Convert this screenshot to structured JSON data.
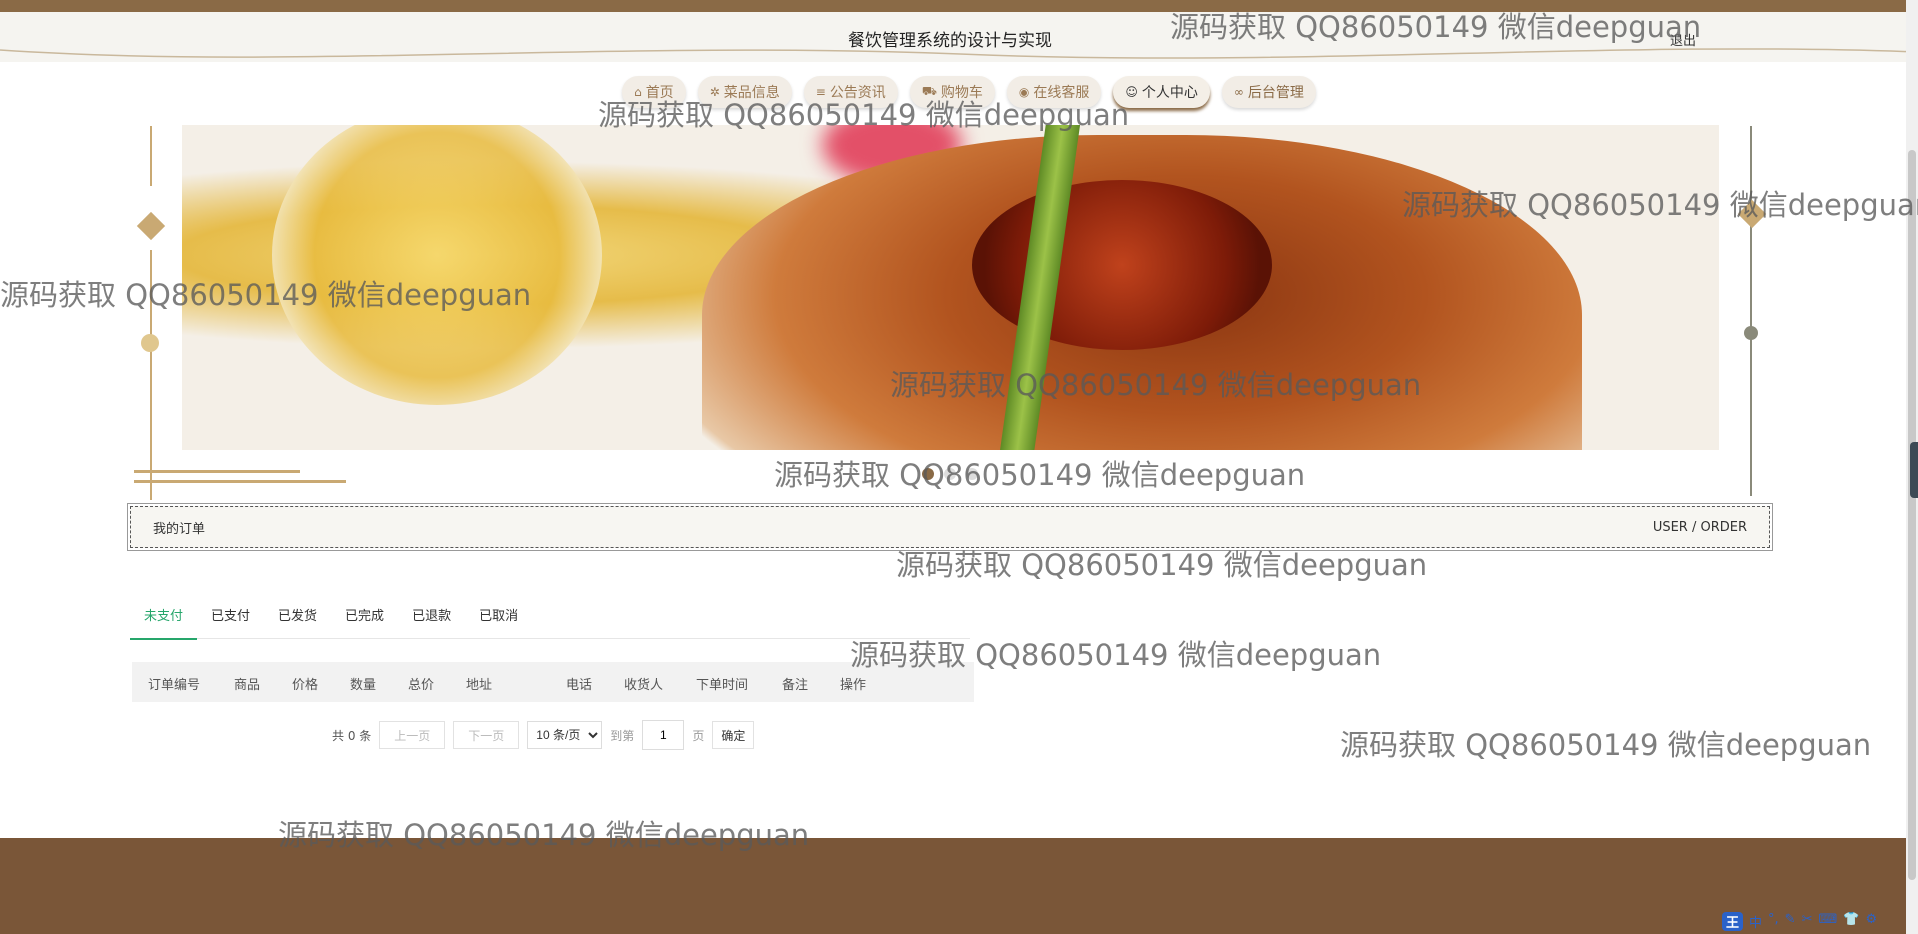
{
  "header": {
    "title": "餐饮管理系统的设计与实现",
    "logout_label": "退出"
  },
  "nav": {
    "items": [
      {
        "icon": "home-icon",
        "glyph": "⌂",
        "label": "首页"
      },
      {
        "icon": "dish-icon",
        "glyph": "✲",
        "label": "菜品信息"
      },
      {
        "icon": "notice-icon",
        "glyph": "≡",
        "label": "公告资讯"
      },
      {
        "icon": "cart-icon",
        "glyph": "⛟",
        "label": "购物车"
      },
      {
        "icon": "chat-icon",
        "glyph": "◉",
        "label": "在线客服"
      },
      {
        "icon": "user-icon",
        "glyph": "☺",
        "label": "个人中心",
        "active": true
      },
      {
        "icon": "link-icon",
        "glyph": "∞",
        "label": "后台管理"
      }
    ]
  },
  "section": {
    "title": "我的订单",
    "subtitle": "USER / ORDER"
  },
  "tabs": [
    {
      "label": "未支付",
      "active": true
    },
    {
      "label": "已支付"
    },
    {
      "label": "已发货"
    },
    {
      "label": "已完成"
    },
    {
      "label": "已退款"
    },
    {
      "label": "已取消"
    }
  ],
  "table": {
    "columns": [
      "订单编号",
      "商品",
      "价格",
      "数量",
      "总价",
      "地址",
      "电话",
      "收货人",
      "下单时间",
      "备注",
      "操作"
    ],
    "rows": []
  },
  "pager": {
    "total": "共 0 条",
    "prev": "上一页",
    "next": "下一页",
    "page_size": "10 条/页",
    "page_size_options": [
      "10 条/页"
    ],
    "goto_label": "到第",
    "page_value": "1",
    "page_suffix": "页",
    "confirm": "确定"
  },
  "carousel": {
    "count": 3,
    "active_index": 0
  },
  "watermark_text": "源码获取 QQ86050149 微信deepguan",
  "ime": {
    "badge": "王",
    "items": [
      "中",
      "°,",
      "✎",
      "✂",
      "⌨",
      "👕",
      "⚙"
    ]
  },
  "colors": {
    "brand_brown": "#8a6a46",
    "footer_brown": "#7a5638",
    "tab_active_green": "#26a66b"
  }
}
